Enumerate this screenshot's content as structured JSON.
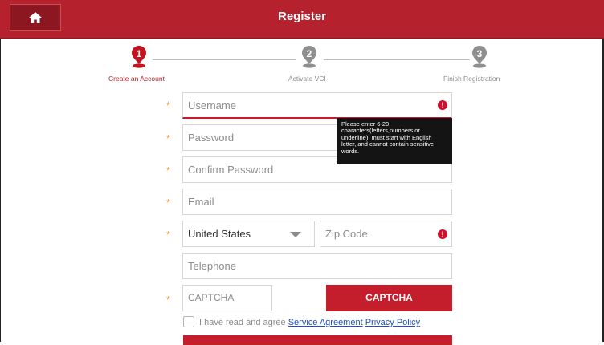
{
  "header": {
    "title": "Register",
    "home_icon": "home-icon"
  },
  "steps": [
    {
      "num": "1",
      "label": "Create an Account",
      "state": "active",
      "color": "#b5212d"
    },
    {
      "num": "2",
      "label": "Activate VCI",
      "state": "inactive",
      "color": "#8a8a8a"
    },
    {
      "num": "3",
      "label": "Finish Registration",
      "state": "inactive",
      "color": "#8a8a8a"
    }
  ],
  "form": {
    "required_mark": "*",
    "username_placeholder": "Username",
    "password_placeholder": "Password",
    "confirm_placeholder": "Confirm Password",
    "email_placeholder": "Email",
    "country_value": "United States",
    "zip_placeholder": "Zip Code",
    "telephone_placeholder": "Telephone",
    "captcha_placeholder": "CAPTCHA",
    "captcha_button": "CAPTCHA",
    "error_mark": "!"
  },
  "tooltip": {
    "text": "Please enter 6-20 characters(letters,numbers or underline), must start with English letter, and cannot contain sensitive words."
  },
  "agreement": {
    "prefix": "I have read and agree",
    "service_link": "Service Agreement",
    "privacy_link": "Privacy Policy"
  },
  "colors": {
    "brand": "#b5212d",
    "required": "#f39c3a",
    "error": "#d0102b",
    "link": "#1f4fc2"
  }
}
